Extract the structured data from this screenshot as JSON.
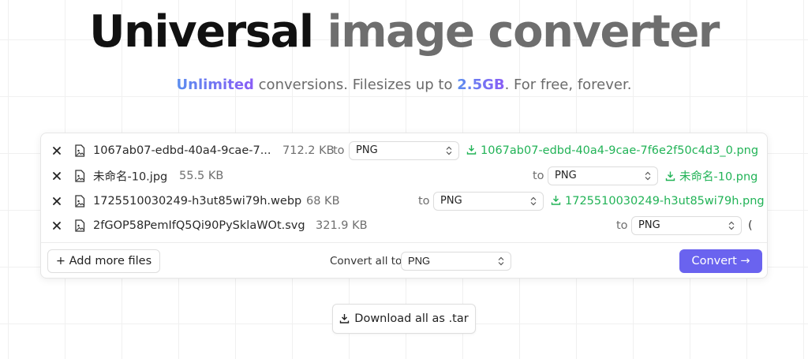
{
  "hero": {
    "title_part1": "Universal",
    "title_part2": "image converter",
    "subtitle_highlight1": "Unlimited",
    "subtitle_text1": " conversions. Filesizes up to ",
    "subtitle_highlight2": "2.5GB",
    "subtitle_text2": ". For free, forever."
  },
  "files": [
    {
      "name": "1067ab07-edbd-40a4-9cae-7...",
      "size": "712.2 KB",
      "to_label": "to",
      "format": "PNG",
      "output": "1067ab07-edbd-40a4-9cae-7f6e2f50c4d3_0.png"
    },
    {
      "name": "未命名-10.jpg",
      "size": "55.5 KB",
      "to_label": "to",
      "format": "PNG",
      "output": "未命名-10.png"
    },
    {
      "name": "1725510030249-h3ut85wi79h.webp",
      "size": "68 KB",
      "to_label": "to",
      "format": "PNG",
      "output": "1725510030249-h3ut85wi79h.png"
    },
    {
      "name": "2fGOP58PemIfQ5Qi90PySklaWOt.svg",
      "size": "321.9 KB",
      "to_label": "to",
      "format": "PNG",
      "output": "("
    }
  ],
  "footer": {
    "add_more": "+ Add more files",
    "convert_all_label": "Convert all to",
    "convert_all_format": "PNG",
    "convert_button": "Convert →"
  },
  "download_all": "Download all as .tar",
  "colors": {
    "accent": "#6a63ef",
    "success": "#22b357",
    "gradient_start": "#5b8def",
    "gradient_end": "#8a5cf6"
  },
  "icons": {
    "remove": "close-icon",
    "file": "image-file-icon",
    "download": "download-icon",
    "select": "chevron-updown-icon"
  }
}
